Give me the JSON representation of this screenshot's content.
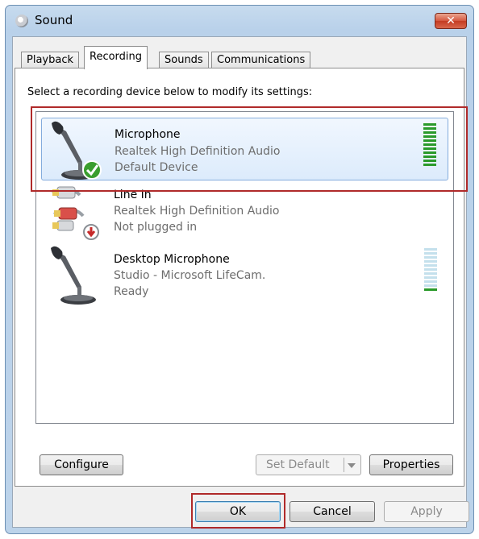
{
  "window": {
    "title": "Sound",
    "close_glyph": "✕",
    "close_icon": "close-icon",
    "app_icon": "speaker-icon"
  },
  "tabs": [
    {
      "label": "Playback",
      "active": false
    },
    {
      "label": "Recording",
      "active": true
    },
    {
      "label": "Sounds",
      "active": false
    },
    {
      "label": "Communications",
      "active": false
    }
  ],
  "instruction": "Select a recording device below to modify its settings:",
  "devices": [
    {
      "name": "Microphone",
      "driver": "Realtek High Definition Audio",
      "status": "Default Device",
      "icon": "microphone-icon",
      "badge": "default-check-icon",
      "selected": true,
      "level_bars_on": 11,
      "level_bars_total": 11
    },
    {
      "name": "Line In",
      "driver": "Realtek High Definition Audio",
      "status": "Not plugged in",
      "icon": "line-in-cable-icon",
      "badge": "unplugged-arrow-icon",
      "selected": false
    },
    {
      "name": "Desktop Microphone",
      "driver": "Studio - Microsoft LifeCam.",
      "status": "Ready",
      "icon": "desktop-microphone-icon",
      "selected": false,
      "level_bars_on": 1,
      "level_bars_total": 11
    }
  ],
  "buttons": {
    "configure": "Configure",
    "set_default": "Set Default",
    "properties": "Properties",
    "ok": "OK",
    "cancel": "Cancel",
    "apply": "Apply"
  },
  "colors": {
    "highlight": "#b02a2a",
    "meter_on": "#2a9a2a",
    "meter_off": "#c4e0ec",
    "selection": "#84acdd"
  }
}
